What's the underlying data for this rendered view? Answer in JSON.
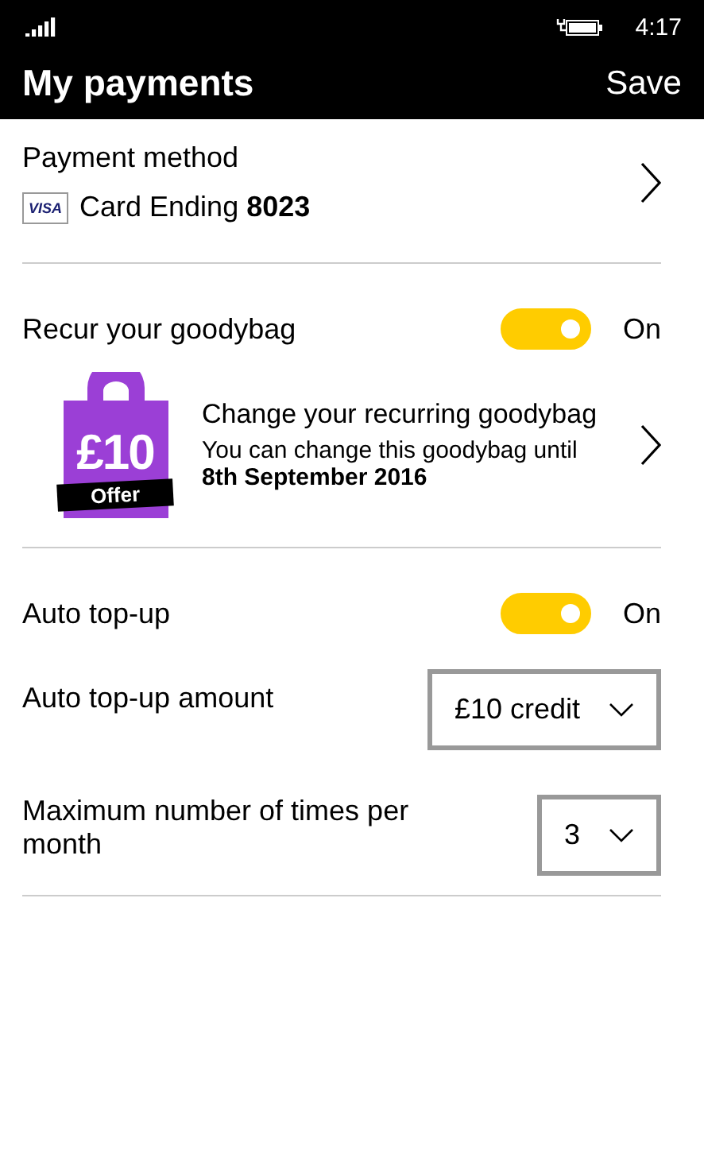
{
  "status_bar": {
    "time": "4:17"
  },
  "header": {
    "title": "My payments",
    "action": "Save"
  },
  "payment_method": {
    "label": "Payment method",
    "card_brand": "VISA",
    "card_text": "Card Ending ",
    "card_number": "8023"
  },
  "recur": {
    "label": "Recur your goodybag",
    "on": true,
    "state_text": "On"
  },
  "offer": {
    "price": "£10",
    "ribbon": "Offer",
    "title": "Change your recurring goodybag",
    "note": "You can change this goodybag until",
    "date": "8th September 2016"
  },
  "auto_topup": {
    "label": "Auto top-up",
    "on": true,
    "state_text": "On"
  },
  "dropdowns": [
    {
      "label": "Auto top-up amount",
      "value": "£10 credit"
    },
    {
      "label": "Maximum number of times per month",
      "value": "3"
    }
  ]
}
